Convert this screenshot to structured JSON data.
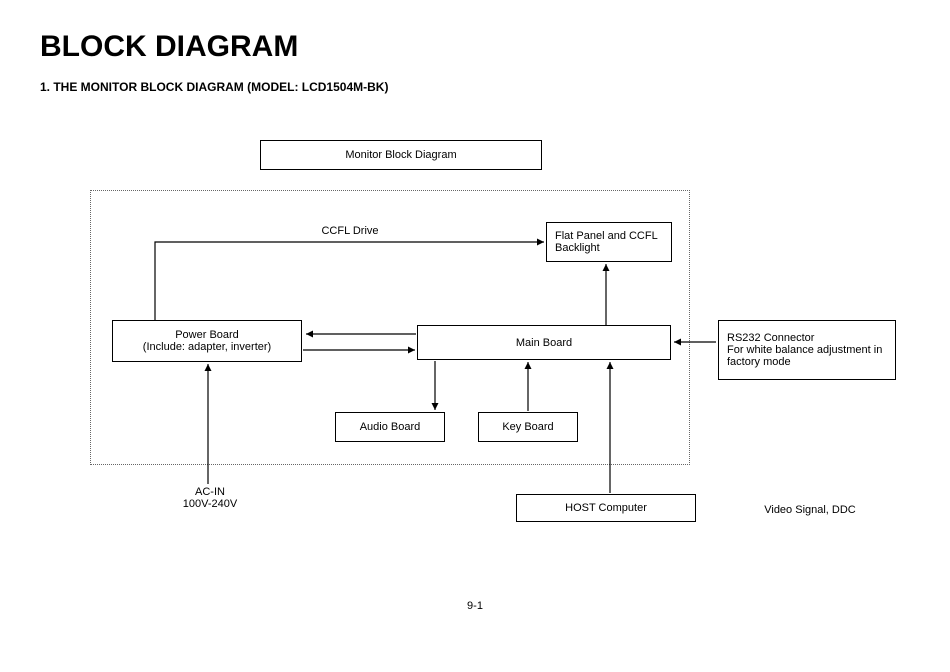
{
  "header": {
    "title": "BLOCK DIAGRAM",
    "subtitle": "1.  THE MONITOR BLOCK DIAGRAM (MODEL: LCD1504M-BK)"
  },
  "blocks": {
    "diagram_title": "Monitor Block Diagram",
    "power_board_line1": "Power Board",
    "power_board_line2": "(Include: adapter, inverter)",
    "main_board": "Main Board",
    "flat_panel_line1": "Flat Panel and CCFL",
    "flat_panel_line2": "Backlight",
    "audio_board": "Audio Board",
    "key_board": "Key Board",
    "rs232_line1": "RS232 Connector",
    "rs232_line2": "For white balance adjustment in",
    "rs232_line3": "factory mode",
    "host_computer": "HOST Computer"
  },
  "labels": {
    "ccfl_drive": "CCFL Drive",
    "ac_in_line1": "AC-IN",
    "ac_in_line2": "100V-240V",
    "video_signal": "Video Signal, DDC"
  },
  "page_number": "9-1"
}
